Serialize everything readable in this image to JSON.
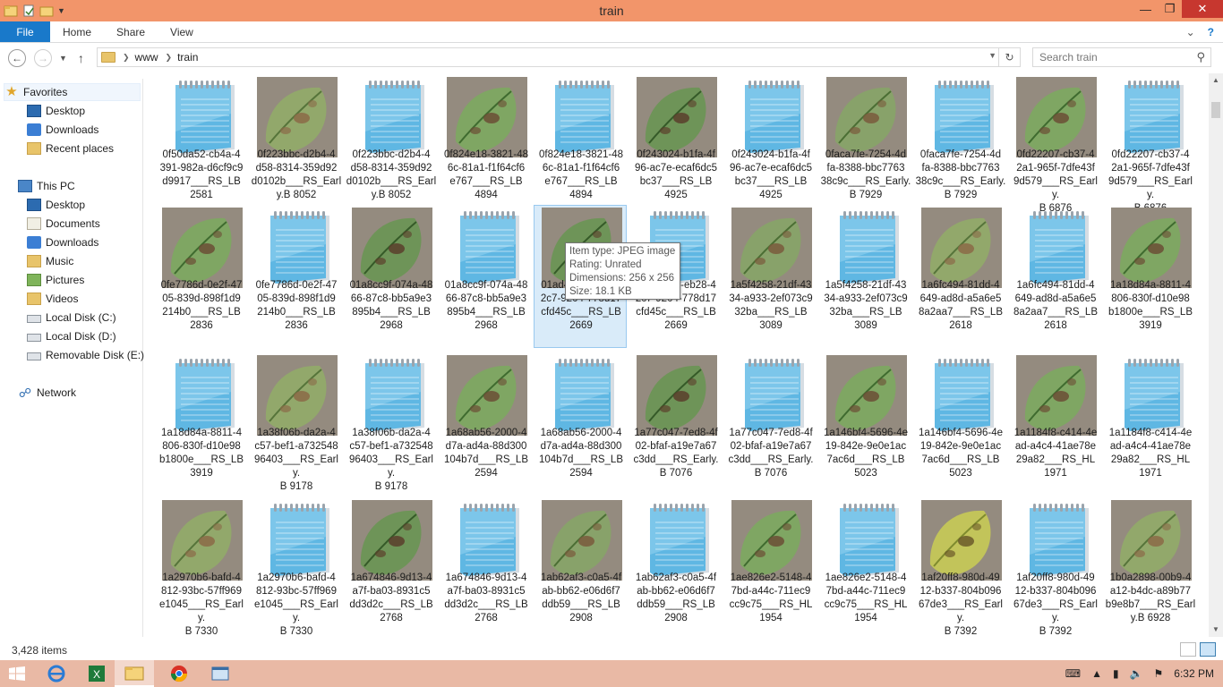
{
  "window": {
    "title": "train",
    "controls": [
      "minimize-icon",
      "restore-icon",
      "close-icon"
    ]
  },
  "ribbon": {
    "tabs": [
      {
        "label": "File",
        "active": true
      },
      {
        "label": "Home"
      },
      {
        "label": "Share"
      },
      {
        "label": "View"
      }
    ]
  },
  "address": {
    "crumbs": [
      "www",
      "train"
    ]
  },
  "search": {
    "placeholder": "Search train"
  },
  "nav": {
    "favorites": {
      "label": "Favorites",
      "items": [
        "Desktop",
        "Downloads",
        "Recent places"
      ]
    },
    "thispc": {
      "label": "This PC",
      "items": [
        "Desktop",
        "Documents",
        "Downloads",
        "Music",
        "Pictures",
        "Videos",
        "Local Disk (C:)",
        "Local Disk (D:)",
        "Removable Disk (E:)"
      ]
    },
    "network": {
      "label": "Network"
    }
  },
  "files": [
    {
      "kind": "txt",
      "name": "0f50da52-cb4a-4\n391-982a-d6cf9c9\nd9917___RS_LB\n2581"
    },
    {
      "kind": "img",
      "leaf": 2,
      "name": "0f223bbc-d2b4-4\nd58-8314-359d92\nd0102b___RS_Earl\ny.B 8052"
    },
    {
      "kind": "txt",
      "name": "0f223bbc-d2b4-4\nd58-8314-359d92\nd0102b___RS_Earl\ny.B 8052"
    },
    {
      "kind": "img",
      "leaf": 1,
      "name": "0f824e18-3821-48\n6c-81a1-f1f64cf6\ne767___RS_LB\n4894"
    },
    {
      "kind": "txt",
      "name": "0f824e18-3821-48\n6c-81a1-f1f64cf6\ne767___RS_LB\n4894"
    },
    {
      "kind": "img",
      "leaf": 3,
      "name": "0f243024-b1fa-4f\n96-ac7e-ecaf6dc5\nbc37___RS_LB\n4925"
    },
    {
      "kind": "txt",
      "name": "0f243024-b1fa-4f\n96-ac7e-ecaf6dc5\nbc37___RS_LB\n4925"
    },
    {
      "kind": "img",
      "leaf": 4,
      "name": "0faca7fe-7254-4d\nfa-8388-bbc7763\n38c9c___RS_Early.\nB 7929"
    },
    {
      "kind": "txt",
      "name": "0faca7fe-7254-4d\nfa-8388-bbc7763\n38c9c___RS_Early.\nB 7929"
    },
    {
      "kind": "img",
      "leaf": 1,
      "name": "0fd22207-cb37-4\n2a1-965f-7dfe43f\n9d579___RS_Early.\nB 6876"
    },
    {
      "kind": "txt",
      "name": "0fd22207-cb37-4\n2a1-965f-7dfe43f\n9d579___RS_Early.\nB 6876"
    },
    {
      "kind": "img",
      "leaf": 1,
      "name": "0fe7786d-0e2f-47\n05-839d-898f1d9\n214b0___RS_LB\n2836"
    },
    {
      "kind": "txt",
      "name": "0fe7786d-0e2f-47\n05-839d-898f1d9\n214b0___RS_LB\n2836"
    },
    {
      "kind": "img",
      "leaf": 3,
      "name": "01a8cc9f-074a-48\n66-87c8-bb5a9e3\n895b4___RS_LB\n2968"
    },
    {
      "kind": "txt",
      "name": "01a8cc9f-074a-48\n66-87c8-bb5a9e3\n895b4___RS_LB\n2968"
    },
    {
      "kind": "img",
      "leaf": 3,
      "selected": true,
      "name": "01ad4cc6-eb28-4\n2c7-9204-778d17\ncfd45c___RS_LB\n2669"
    },
    {
      "kind": "txt",
      "name": "01ad4cc6-eb28-4\n2c7-9204-778d17\ncfd45c___RS_LB\n2669"
    },
    {
      "kind": "img",
      "leaf": 4,
      "name": "1a5f4258-21df-43\n34-a933-2ef073c9\n32ba___RS_LB\n3089"
    },
    {
      "kind": "txt",
      "name": "1a5f4258-21df-43\n34-a933-2ef073c9\n32ba___RS_LB\n3089"
    },
    {
      "kind": "img",
      "leaf": 2,
      "name": "1a6fc494-81dd-4\n649-ad8d-a5a6e5\n8a2aa7___RS_LB\n2618"
    },
    {
      "kind": "txt",
      "name": "1a6fc494-81dd-4\n649-ad8d-a5a6e5\n8a2aa7___RS_LB\n2618"
    },
    {
      "kind": "img",
      "leaf": 1,
      "name": "1a18d84a-8811-4\n806-830f-d10e98\nb1800e___RS_LB\n3919"
    },
    {
      "kind": "txt",
      "name": "1a18d84a-8811-4\n806-830f-d10e98\nb1800e___RS_LB\n3919"
    },
    {
      "kind": "img",
      "leaf": 2,
      "name": "1a38f06b-da2a-4\nc57-bef1-a732548\n96403___RS_Early.\nB 9178"
    },
    {
      "kind": "txt",
      "name": "1a38f06b-da2a-4\nc57-bef1-a732548\n96403___RS_Early.\nB 9178"
    },
    {
      "kind": "img",
      "leaf": 1,
      "name": "1a68ab56-2000-4\nd7a-ad4a-88d300\n104b7d___RS_LB\n2594"
    },
    {
      "kind": "txt",
      "name": "1a68ab56-2000-4\nd7a-ad4a-88d300\n104b7d___RS_LB\n2594"
    },
    {
      "kind": "img",
      "leaf": 3,
      "name": "1a77c047-7ed8-4f\n02-bfaf-a19e7a67\nc3dd___RS_Early.\nB 7076"
    },
    {
      "kind": "txt",
      "name": "1a77c047-7ed8-4f\n02-bfaf-a19e7a67\nc3dd___RS_Early.\nB 7076"
    },
    {
      "kind": "img",
      "leaf": 1,
      "name": "1a146bf4-5696-4e\n19-842e-9e0e1ac\n7ac6d___RS_LB\n5023"
    },
    {
      "kind": "txt",
      "name": "1a146bf4-5696-4e\n19-842e-9e0e1ac\n7ac6d___RS_LB\n5023"
    },
    {
      "kind": "img",
      "leaf": 1,
      "name": "1a1184f8-c414-4e\nad-a4c4-41ae78e\n29a82___RS_HL\n1971"
    },
    {
      "kind": "txt",
      "name": "1a1184f8-c414-4e\nad-a4c4-41ae78e\n29a82___RS_HL\n1971"
    },
    {
      "kind": "img",
      "leaf": 2,
      "name": "1a2970b6-bafd-4\n812-93bc-57ff969\ne1045___RS_Early.\nB 7330"
    },
    {
      "kind": "txt",
      "name": "1a2970b6-bafd-4\n812-93bc-57ff969\ne1045___RS_Early.\nB 7330"
    },
    {
      "kind": "img",
      "leaf": 3,
      "name": "1a674846-9d13-4\na7f-ba03-8931c5\ndd3d2c___RS_LB\n2768"
    },
    {
      "kind": "txt",
      "name": "1a674846-9d13-4\na7f-ba03-8931c5\ndd3d2c___RS_LB\n2768"
    },
    {
      "kind": "img",
      "leaf": 4,
      "name": "1ab62af3-c0a5-4f\nab-bb62-e06d6f7\nddb59___RS_LB\n2908"
    },
    {
      "kind": "txt",
      "name": "1ab62af3-c0a5-4f\nab-bb62-e06d6f7\nddb59___RS_LB\n2908"
    },
    {
      "kind": "img",
      "leaf": 1,
      "name": "1ae826e2-5148-4\n7bd-a44c-711ec9\ncc9c75___RS_HL\n1954"
    },
    {
      "kind": "txt",
      "name": "1ae826e2-5148-4\n7bd-a44c-711ec9\ncc9c75___RS_HL\n1954"
    },
    {
      "kind": "img",
      "leaf": 5,
      "name": "1af20ff8-980d-49\n12-b337-804b096\n67de3___RS_Early.\nB 7392"
    },
    {
      "kind": "txt",
      "name": "1af20ff8-980d-49\n12-b337-804b096\n67de3___RS_Early.\nB 7392"
    },
    {
      "kind": "img",
      "leaf": 2,
      "name": "1b0a2898-00b9-4\na12-b4dc-a89b77\nb9e8b7___RS_Earl\ny.B 6928"
    }
  ],
  "tooltip": {
    "lines": [
      "Item type: JPEG image",
      "Rating: Unrated",
      "Dimensions: 256 x 256",
      "Size: 18.1 KB"
    ]
  },
  "status": {
    "count": "3,428 items"
  },
  "taskbar": {
    "time": "6:32 PM",
    "apps": [
      "ie-icon",
      "excel-icon",
      "file-explorer-icon",
      "chrome-icon",
      "explorer-window-icon"
    ]
  },
  "colors": {
    "titlebar": "#f2956a",
    "file_tab": "#1979ca",
    "selection": "#d9ebf9",
    "taskbar": "#e9b9a5",
    "close": "#c7372f"
  }
}
